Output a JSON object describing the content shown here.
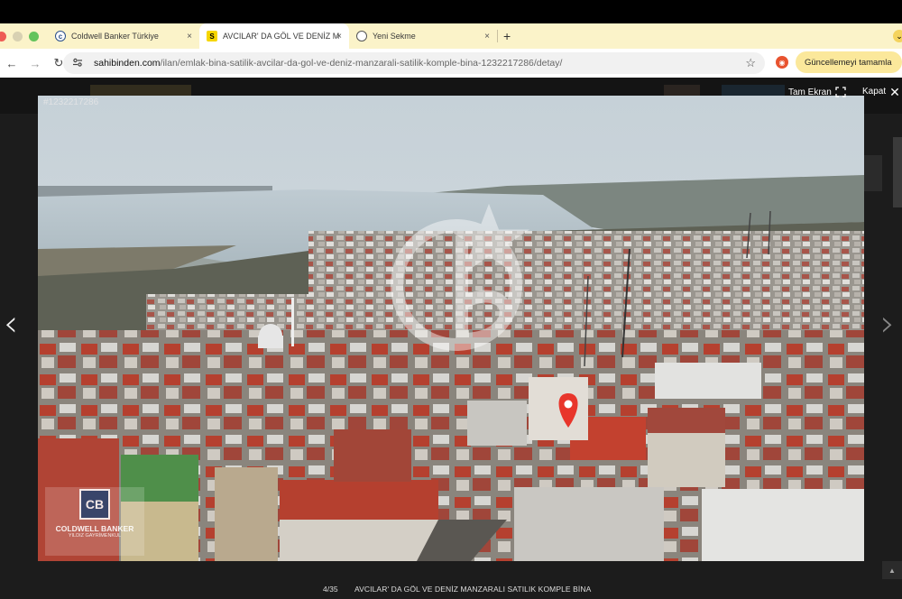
{
  "browser": {
    "tabs": [
      {
        "title": "Coldwell Banker Türkiye",
        "favicon": "coldwell-banker-icon",
        "close": "×"
      },
      {
        "title": "AVCILAR' DA GÖL VE DENİZ M",
        "favicon": "sahibinden-icon",
        "fav_text": "S",
        "close": "×",
        "active": true
      },
      {
        "title": "Yeni Sekme",
        "favicon": "globe-icon",
        "close": "×"
      }
    ],
    "new_tab": "+",
    "menu_chevron": "⌄",
    "url_host": "sahibinden.com",
    "url_path": "/ilan/emlak-bina-satilik-avcilar-da-gol-ve-deniz-manzarali-satilik-komple-bina-1232217286/detay/",
    "update_button": "Güncellemeyi tamamla",
    "update_dots": "⋮"
  },
  "viewer": {
    "fullscreen_label": "Tam Ekran",
    "close_label": "Kapat",
    "listing_number": "#1232217286",
    "counter": "4/35",
    "caption": "AVCILAR' DA GÖL VE DENİZ MANZARALI SATILIK KOMPLE BİNA",
    "logo_line1": "COLDWELL BANKER",
    "logo_line2": "YILDIZ GAYRİMENKUL",
    "logo_mark": "CB",
    "colors": {
      "tab_bar": "#fbf3c9",
      "pin": "#e8352b",
      "roof": "#b5402f",
      "water": "#b4c3cc"
    }
  }
}
